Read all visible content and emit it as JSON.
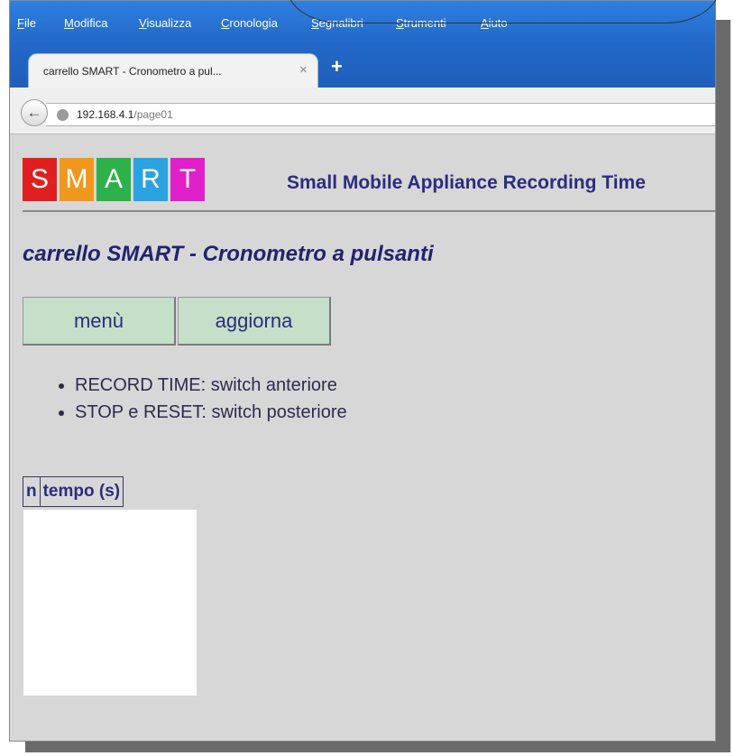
{
  "menu": [
    "File",
    "Modifica",
    "Visualizza",
    "Cronologia",
    "Segnalibri",
    "Strumenti",
    "Aiuto"
  ],
  "tab": {
    "title": "carrello SMART - Cronometro a pul...",
    "close_icon": "×",
    "new_tab_icon": "+"
  },
  "address": {
    "host": "192.168.4.1",
    "path": "/page01"
  },
  "logo": {
    "letters": [
      {
        "char": "S",
        "color": "#e02020"
      },
      {
        "char": "M",
        "color": "#f0981e"
      },
      {
        "char": "A",
        "color": "#2eb04b"
      },
      {
        "char": "R",
        "color": "#2aa3e0"
      },
      {
        "char": "T",
        "color": "#e020c8"
      }
    ],
    "tagline": "Small Mobile Appliance Recording Time"
  },
  "page": {
    "title": "carrello SMART - Cronometro a pulsanti",
    "buttons": {
      "menu": "menù",
      "refresh": "aggiorna"
    },
    "instructions": [
      "RECORD TIME: switch anteriore",
      "STOP e RESET: switch posteriore"
    ],
    "table": {
      "headers": [
        "n",
        "tempo (s)"
      ]
    }
  }
}
